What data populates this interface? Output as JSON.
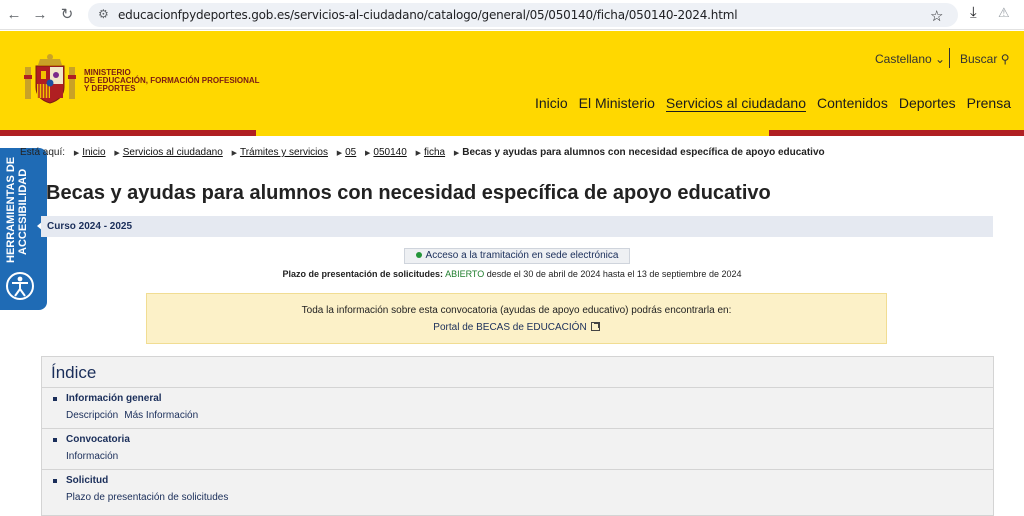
{
  "browser": {
    "url": "educacionfpydeportes.gob.es/servicios-al-ciudadano/catalogo/general/05/050140/ficha/050140-2024.html"
  },
  "header": {
    "ministry_lines": [
      "MINISTERIO",
      "DE EDUCACIÓN, FORMACIÓN PROFESIONAL",
      "Y DEPORTES"
    ],
    "language": "Castellano",
    "search": "Buscar",
    "menu": [
      "Inicio",
      "El Ministerio",
      "Servicios al ciudadano",
      "Contenidos",
      "Deportes",
      "Prensa"
    ]
  },
  "accessibility": {
    "label_line1": "HERRAMIENTAS DE",
    "label_line2": "ACCESIBILIDAD"
  },
  "breadcrumb": {
    "prefix": "Está aquí:",
    "items": [
      "Inicio",
      "Servicios al ciudadano",
      "Trámites y servicios",
      "05",
      "050140",
      "ficha"
    ],
    "current": "Becas y ayudas para alumnos con necesidad específica de apoyo educativo"
  },
  "page": {
    "title": "Becas y ayudas para alumnos con necesidad específica de apoyo educativo",
    "curso": "Curso 2024 - 2025",
    "tramitacion": "Acceso a la tramitación en sede electrónica",
    "plazo_label": "Plazo de presentación de solicitudes:",
    "plazo_status": "ABIERTO",
    "plazo_dates": "desde el 30 de abril de 2024 hasta el 13 de septiembre de 2024",
    "info_text": "Toda la información sobre esta convocatoria (ayudas de apoyo educativo) podrás encontrarla en:",
    "info_link": "Portal de BECAS de EDUCACIÓN"
  },
  "indice": {
    "title": "Índice",
    "sections": [
      {
        "title": "Información general",
        "links": [
          "Descripción",
          "Más Información"
        ]
      },
      {
        "title": "Convocatoria",
        "links": [
          "Información"
        ]
      },
      {
        "title": "Solicitud",
        "links": [
          "Plazo de presentación de solicitudes"
        ]
      }
    ]
  },
  "colors": {
    "header_yellow": "#ffd800",
    "stripe_red": "#b01f22",
    "accessibility_blue": "#1f6bb5",
    "status_green": "#24953a"
  }
}
